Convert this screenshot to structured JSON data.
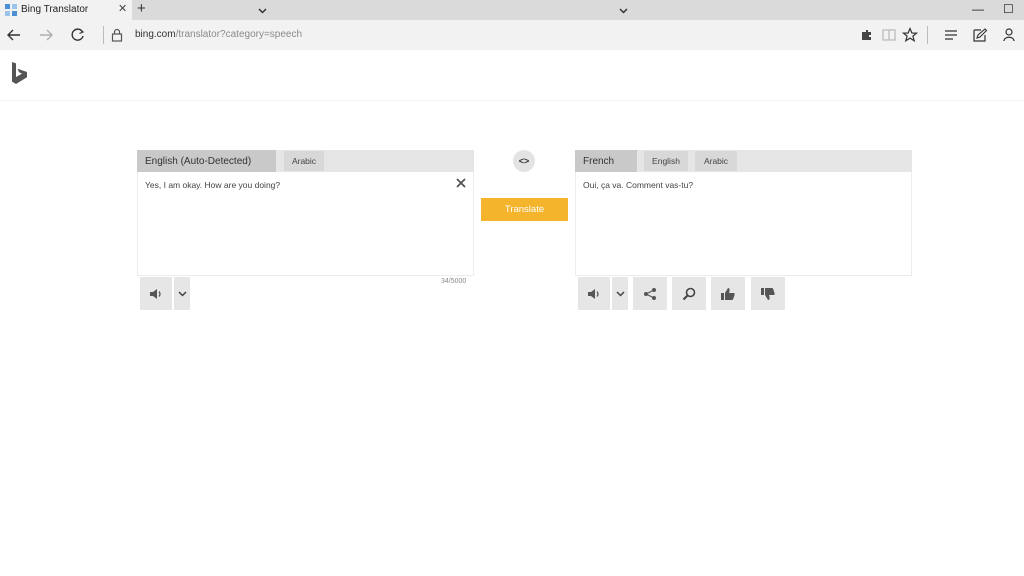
{
  "browser": {
    "tab_title": "Bing Translator",
    "tab_close": "✕",
    "new_tab": "+",
    "url_host": "bing.com",
    "url_path": "/translator?category=speech",
    "minimize": "—",
    "maximize": "☐"
  },
  "source": {
    "language": "English (Auto-Detected)",
    "tabs": [
      "Arabic"
    ],
    "text": "Yes, I am okay. How are you doing?",
    "char_count": "34/5000"
  },
  "target": {
    "language": "French",
    "tabs": [
      "English",
      "Arabic"
    ],
    "text": "Oui, ça va. Comment vas-tu?"
  },
  "controls": {
    "swap": "<>",
    "translate": "Translate"
  },
  "colors": {
    "accent": "#f4b42b",
    "panel_header": "#e6e6e6",
    "selected_language": "#c9c9c9"
  }
}
